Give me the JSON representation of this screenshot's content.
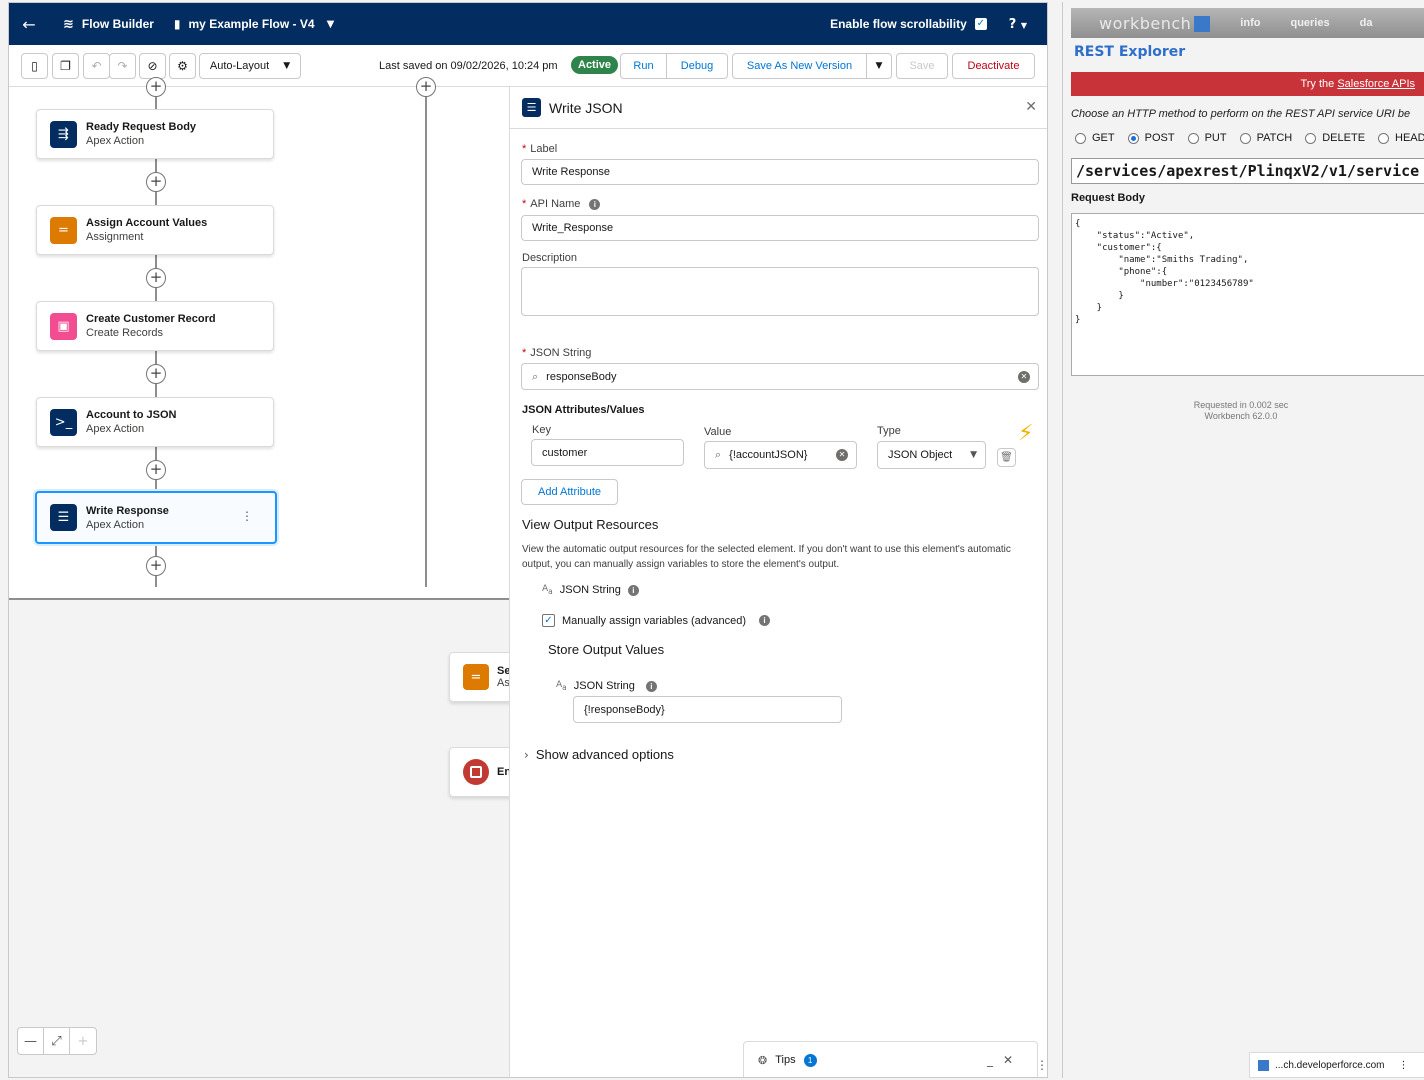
{
  "header": {
    "back_icon": "arrow-left-icon",
    "app_name": "Flow Builder",
    "flow_name": "my Example Flow - V4",
    "scroll_label": "Enable flow scrollability",
    "help_label": "?"
  },
  "toolbar": {
    "layout_label": "Auto-Layout",
    "last_saved": "Last saved on 09/02/2026, 10:24 pm",
    "status": "Active",
    "run": "Run",
    "debug": "Debug",
    "save_new": "Save As New Version",
    "save": "Save",
    "deactivate": "Deactivate"
  },
  "canvas": {
    "nodes": [
      {
        "title": "Ready Request Body",
        "type": "Apex Action",
        "color": "#032d60"
      },
      {
        "title": "Assign Account Values",
        "type": "Assignment",
        "color": "#dd7a01"
      },
      {
        "title": "Create Customer Record",
        "type": "Create Records",
        "color": "#f34d91"
      },
      {
        "title": "Account to JSON",
        "type": "Apex Action",
        "color": "#032d60"
      },
      {
        "title": "Write Response",
        "type": "Apex Action",
        "color": "#032d60"
      }
    ],
    "stub1": {
      "title": "Se",
      "type": "As"
    },
    "stub2": {
      "title": "En"
    }
  },
  "panel": {
    "title": "Write JSON",
    "label_lbl": "Label",
    "label_val": "Write Response",
    "api_lbl": "API Name",
    "api_val": "Write_Response",
    "desc_lbl": "Description",
    "json_lbl": "JSON String",
    "json_val": "responseBody",
    "attrs_lbl": "JSON Attributes/Values",
    "key_lbl": "Key",
    "value_lbl": "Value",
    "type_lbl": "Type",
    "key_val": "customer",
    "value_val": "{!accountJSON}",
    "type_val": "JSON Object",
    "add_attr": "Add Attribute",
    "output_title": "View Output Resources",
    "output_desc": "View the automatic output resources for the selected element. If you don't want to use this element's automatic output, you can manually assign variables to store the element's output.",
    "out_json": "JSON String",
    "manual_lbl": "Manually assign variables (advanced)",
    "store_title": "Store Output Values",
    "store_json_lbl": "JSON String",
    "store_val": "{!responseBody}",
    "advanced": "Show advanced options",
    "tips": "Tips",
    "tips_count": "1"
  },
  "workbench": {
    "logo": "workbench",
    "menu1": "info",
    "menu2": "queries",
    "menu3": "da",
    "title": "REST Explorer",
    "banner_pre": "Try the",
    "banner_link": "Salesforce APIs",
    "instructions": "Choose an HTTP method to perform on the REST API service URI be",
    "methods": [
      "GET",
      "POST",
      "PUT",
      "PATCH",
      "DELETE",
      "HEAD"
    ],
    "selected_method": "POST",
    "uri": "/services/apexrest/PlinqxV2/v1/service",
    "request_body_label": "Request Body",
    "request_body": "{\n    \"status\":\"Active\",\n    \"customer\":{\n        \"name\":\"Smiths Trading\",\n        \"phone\":{\n            \"number\":\"0123456789\"\n        }\n    }\n}",
    "requested_in": "Requested in 0.002 sec",
    "version": "Workbench 62.0.0",
    "status_host": "...ch.developerforce.com"
  }
}
